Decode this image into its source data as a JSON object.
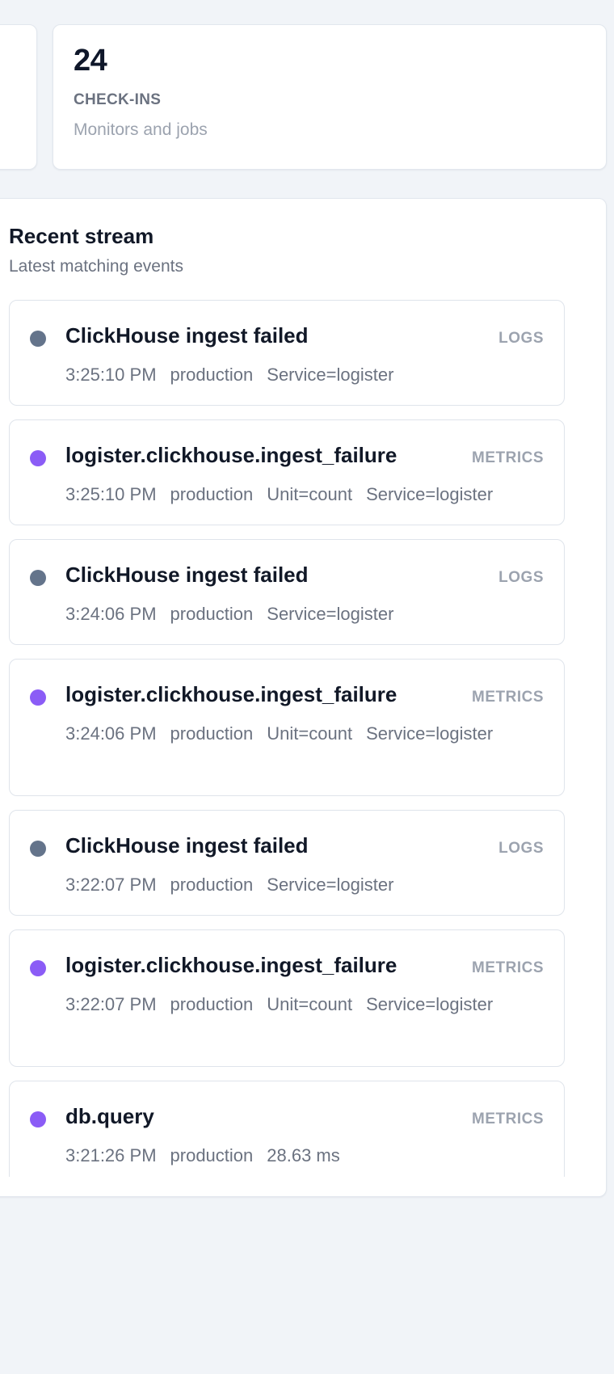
{
  "stat": {
    "value": "24",
    "label": "CHECK-INS",
    "sub": "Monitors and jobs"
  },
  "stream": {
    "title": "Recent stream",
    "subtitle": "Latest matching events",
    "events": [
      {
        "title": "ClickHouse ingest failed",
        "type": "LOGS",
        "dot": "#64748b",
        "meta": [
          "3:25:10 PM",
          "production",
          "Service=logister"
        ]
      },
      {
        "title": "logister.clickhouse.ingest_failure",
        "type": "METRICS",
        "dot": "#8b5cf6",
        "meta": [
          "3:25:10 PM",
          "production",
          "Unit=count",
          "Service=logister"
        ]
      },
      {
        "title": "ClickHouse ingest failed",
        "type": "LOGS",
        "dot": "#64748b",
        "meta": [
          "3:24:06 PM",
          "production",
          "Service=logister"
        ]
      },
      {
        "title": "logister.clickhouse.ingest_failure",
        "type": "METRICS",
        "dot": "#8b5cf6",
        "meta": [
          "3:24:06 PM",
          "production",
          "Unit=count",
          "Service=logister"
        ]
      },
      {
        "title": "ClickHouse ingest failed",
        "type": "LOGS",
        "dot": "#64748b",
        "meta": [
          "3:22:07 PM",
          "production",
          "Service=logister"
        ]
      },
      {
        "title": "logister.clickhouse.ingest_failure",
        "type": "METRICS",
        "dot": "#8b5cf6",
        "meta": [
          "3:22:07 PM",
          "production",
          "Unit=count",
          "Service=logister"
        ]
      },
      {
        "title": "db.query",
        "type": "METRICS",
        "dot": "#8b5cf6",
        "meta": [
          "3:21:26 PM",
          "production",
          "28.63 ms"
        ]
      }
    ]
  }
}
